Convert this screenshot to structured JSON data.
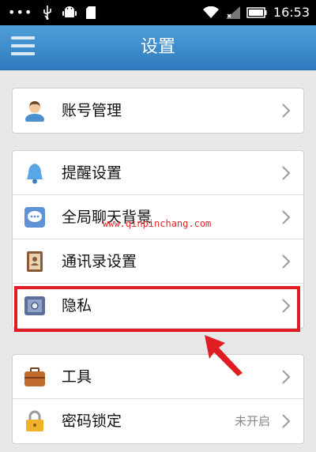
{
  "status_bar": {
    "time": "16:53",
    "left_icons": [
      "more-dots-icon",
      "usb-icon",
      "android-icon",
      "sd-card-icon"
    ],
    "right_icons": [
      "wifi-icon",
      "signal-icon",
      "battery-icon"
    ]
  },
  "header": {
    "title": "设置",
    "menu_icon": "hamburger-menu-icon",
    "background": "#3a8bcc"
  },
  "groups": [
    {
      "items": [
        {
          "label": "账号管理",
          "icon": "user-avatar-icon"
        }
      ]
    },
    {
      "items": [
        {
          "label": "提醒设置",
          "icon": "bell-icon"
        },
        {
          "label": "全局聊天背景",
          "icon": "chat-bubble-icon"
        },
        {
          "label": "通讯录设置",
          "icon": "contacts-book-icon"
        },
        {
          "label": "隐私",
          "icon": "safe-icon",
          "highlighted": true
        }
      ]
    },
    {
      "items": [
        {
          "label": "工具",
          "icon": "toolbox-icon"
        },
        {
          "label": "密码锁定",
          "icon": "padlock-icon",
          "value": "未开启"
        }
      ]
    }
  ],
  "watermark": "www.qinpinchang.com",
  "annotation_color": "#e01d23"
}
